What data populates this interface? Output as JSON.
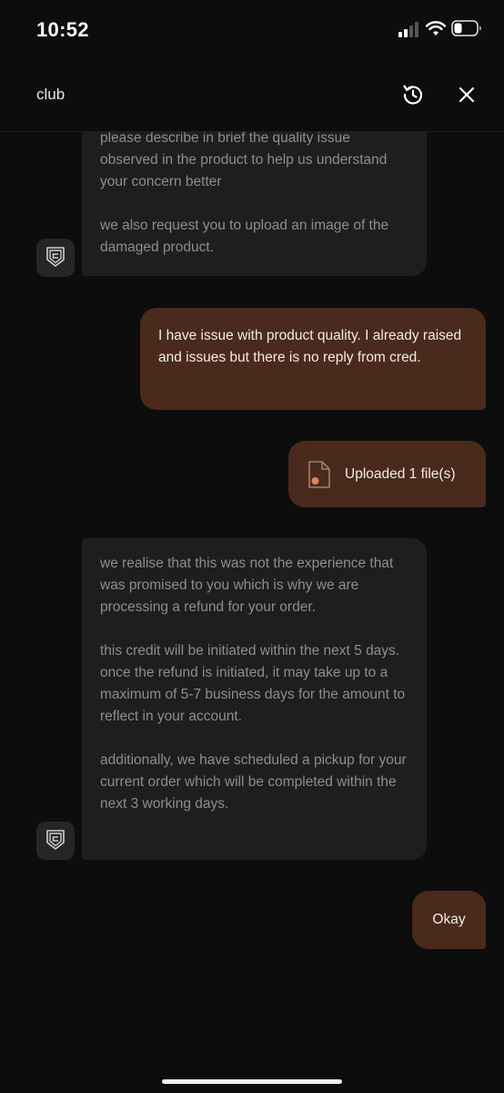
{
  "status_bar": {
    "time": "10:52",
    "battery_level": 0.35
  },
  "header": {
    "title": "club",
    "refresh_icon": "refresh-icon",
    "close_icon": "close-icon"
  },
  "messages": [
    {
      "sender": "bot",
      "paragraphs": [
        "please describe in brief the quality issue observed in the product to help us understand your concern better",
        "we also request you to upload an image of the damaged product."
      ]
    },
    {
      "sender": "user",
      "text": "I have issue with product quality. I already raised  and issues but there is no reply from cred."
    },
    {
      "sender": "user",
      "type": "file",
      "text": "Uploaded 1 file(s)",
      "icon": "file-icon"
    },
    {
      "sender": "bot",
      "paragraphs": [
        "we realise that this was not the experience that was promised to you which is why we are processing a refund for your order.",
        "this credit will be initiated within the next 5 days. once the refund is initiated, it may take up to a maximum of 5-7 business days for the amount to reflect in your account.",
        "additionally, we have scheduled a pickup for your current order which will be completed within the next 3 working days."
      ]
    },
    {
      "sender": "user",
      "text": "Okay"
    }
  ],
  "colors": {
    "background": "#0d0d0d",
    "bot_bubble": "#1e1e1e",
    "bot_text": "#8e8e8e",
    "user_bubble": "#4a2a1c",
    "user_text": "#f2ece8",
    "file_dot": "#e0835a"
  }
}
